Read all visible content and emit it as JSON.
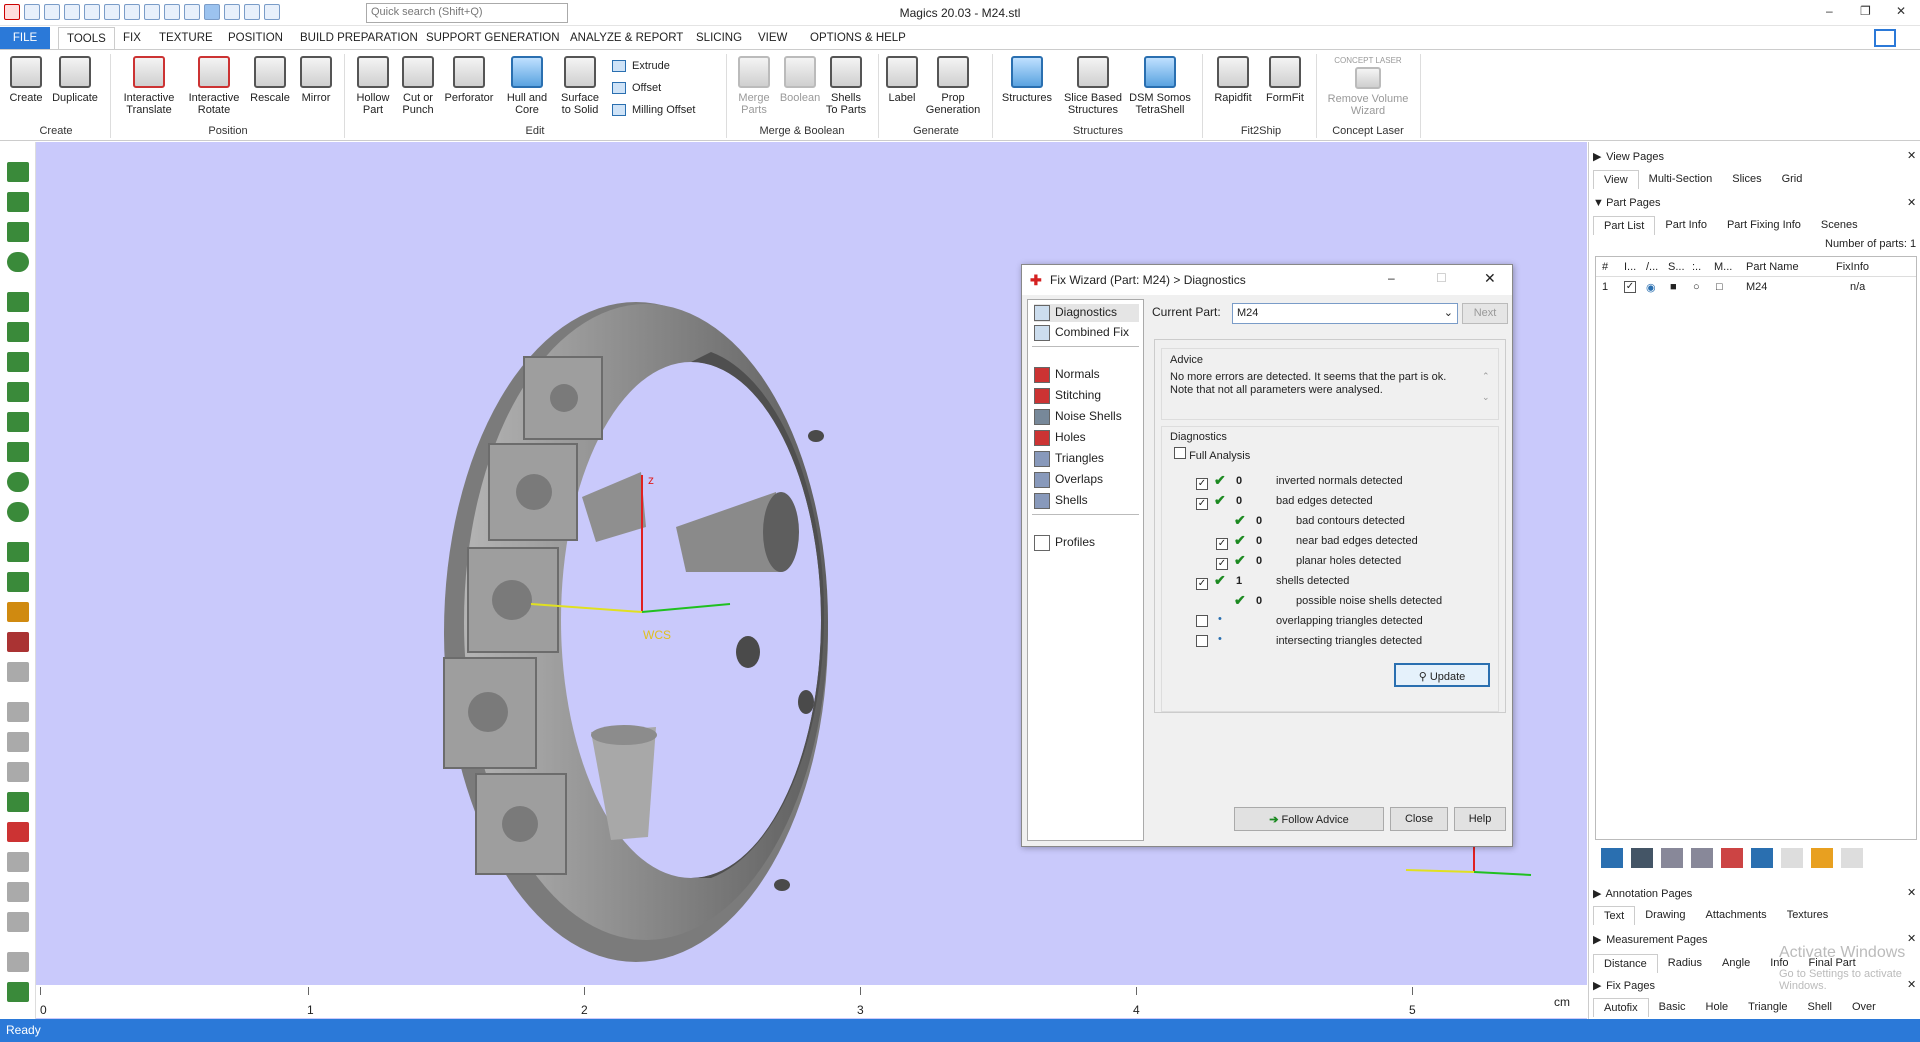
{
  "app": {
    "title": "Magics 20.03 - M24.stl",
    "search_placeholder": "Quick search (Shift+Q)"
  },
  "menu": [
    "FILE",
    "TOOLS",
    "FIX",
    "TEXTURE",
    "POSITION",
    "BUILD PREPARATION",
    "SUPPORT GENERATION",
    "ANALYZE & REPORT",
    "SLICING",
    "VIEW",
    "OPTIONS & HELP"
  ],
  "ribbon": {
    "create": [
      "Create",
      "Duplicate"
    ],
    "create_label": "Create",
    "position": [
      "Interactive Translate",
      "Interactive Rotate",
      "Rescale",
      "Mirror"
    ],
    "position_label": "Position",
    "edit": [
      "Hollow Part",
      "Cut or Punch",
      "Perforator",
      "Hull and Core",
      "Surface to Solid"
    ],
    "edit_small": [
      "Extrude",
      "Offset",
      "Milling Offset"
    ],
    "edit_label": "Edit",
    "merge": [
      "Merge Parts",
      "Boolean",
      "Shells To Parts"
    ],
    "merge_label": "Merge & Boolean",
    "generate": [
      "Label",
      "Prop Generation"
    ],
    "generate_label": "Generate",
    "structures": [
      "Structures",
      "Slice Based Structures",
      "DSM Somos TetraShell"
    ],
    "structures_label": "Structures",
    "fit": [
      "Rapidfit",
      "FormFit"
    ],
    "fit_label": "Fit2Ship",
    "concept": "Remove Volume Wizard",
    "concept_label": "Concept Laser",
    "concept_logo": "CONCEPT LASER"
  },
  "ruler": {
    "ticks": [
      "0",
      "1",
      "2",
      "3",
      "4",
      "5"
    ],
    "unit": "cm"
  },
  "viewport": {
    "axis_z": "z",
    "wcs": "WCS"
  },
  "status": "Ready",
  "right": {
    "view_pages": "View Pages",
    "view_tabs": [
      "View",
      "Multi-Section",
      "Slices",
      "Grid"
    ],
    "part_pages": "Part Pages",
    "part_tabs": [
      "Part List",
      "Part Info",
      "Part Fixing Info",
      "Scenes"
    ],
    "num_parts": "Number of parts: 1",
    "cols": [
      "#",
      "I...",
      "/...",
      "S...",
      ":..",
      "M...",
      "Part Name",
      "FixInfo"
    ],
    "row": {
      "num": "1",
      "name": "M24",
      "fix": "n/a"
    },
    "annotation_pages": "Annotation Pages",
    "annotation_tabs": [
      "Text",
      "Drawing",
      "Attachments",
      "Textures"
    ],
    "measurement_pages": "Measurement Pages",
    "measurement_tabs": [
      "Distance",
      "Radius",
      "Angle",
      "Info",
      "Final Part"
    ],
    "fix_pages": "Fix Pages",
    "fix_tabs": [
      "Autofix",
      "Basic",
      "Hole",
      "Triangle",
      "Shell",
      "Over"
    ],
    "watermark1": "Activate Windows",
    "watermark2": "Go to Settings to activate Windows."
  },
  "dialog": {
    "title": "Fix Wizard (Part: M24) > Diagnostics",
    "nav_top": [
      "Diagnostics",
      "Combined Fix"
    ],
    "nav_mid": [
      "Normals",
      "Stitching",
      "Noise Shells",
      "Holes",
      "Triangles",
      "Overlaps",
      "Shells"
    ],
    "nav_bottom": "Profiles",
    "current_part_label": "Current Part:",
    "current_part": "M24",
    "next": "Next",
    "advice_label": "Advice",
    "advice_text": "No more errors are detected. It seems that the part is ok. Note that not all parameters were analysed.",
    "diagnostics_label": "Diagnostics",
    "full_analysis": "Full Analysis",
    "diags": [
      {
        "count": "0",
        "text": "inverted normals detected",
        "checked": true,
        "indent": 0
      },
      {
        "count": "0",
        "text": "bad edges detected",
        "checked": true,
        "indent": 0
      },
      {
        "count": "0",
        "text": "bad contours detected",
        "checked": null,
        "indent": 1
      },
      {
        "count": "0",
        "text": "near bad edges detected",
        "checked": true,
        "indent": 1
      },
      {
        "count": "0",
        "text": "planar holes detected",
        "checked": true,
        "indent": 1
      },
      {
        "count": "1",
        "text": "shells detected",
        "checked": true,
        "indent": 0
      },
      {
        "count": "0",
        "text": "possible noise shells detected",
        "checked": null,
        "indent": 1
      },
      {
        "count": "",
        "text": "overlapping triangles detected",
        "checked": false,
        "indent": 0
      },
      {
        "count": "",
        "text": "intersecting triangles detected",
        "checked": false,
        "indent": 0
      }
    ],
    "update": "Update",
    "follow": "Follow Advice",
    "close": "Close",
    "help": "Help"
  }
}
